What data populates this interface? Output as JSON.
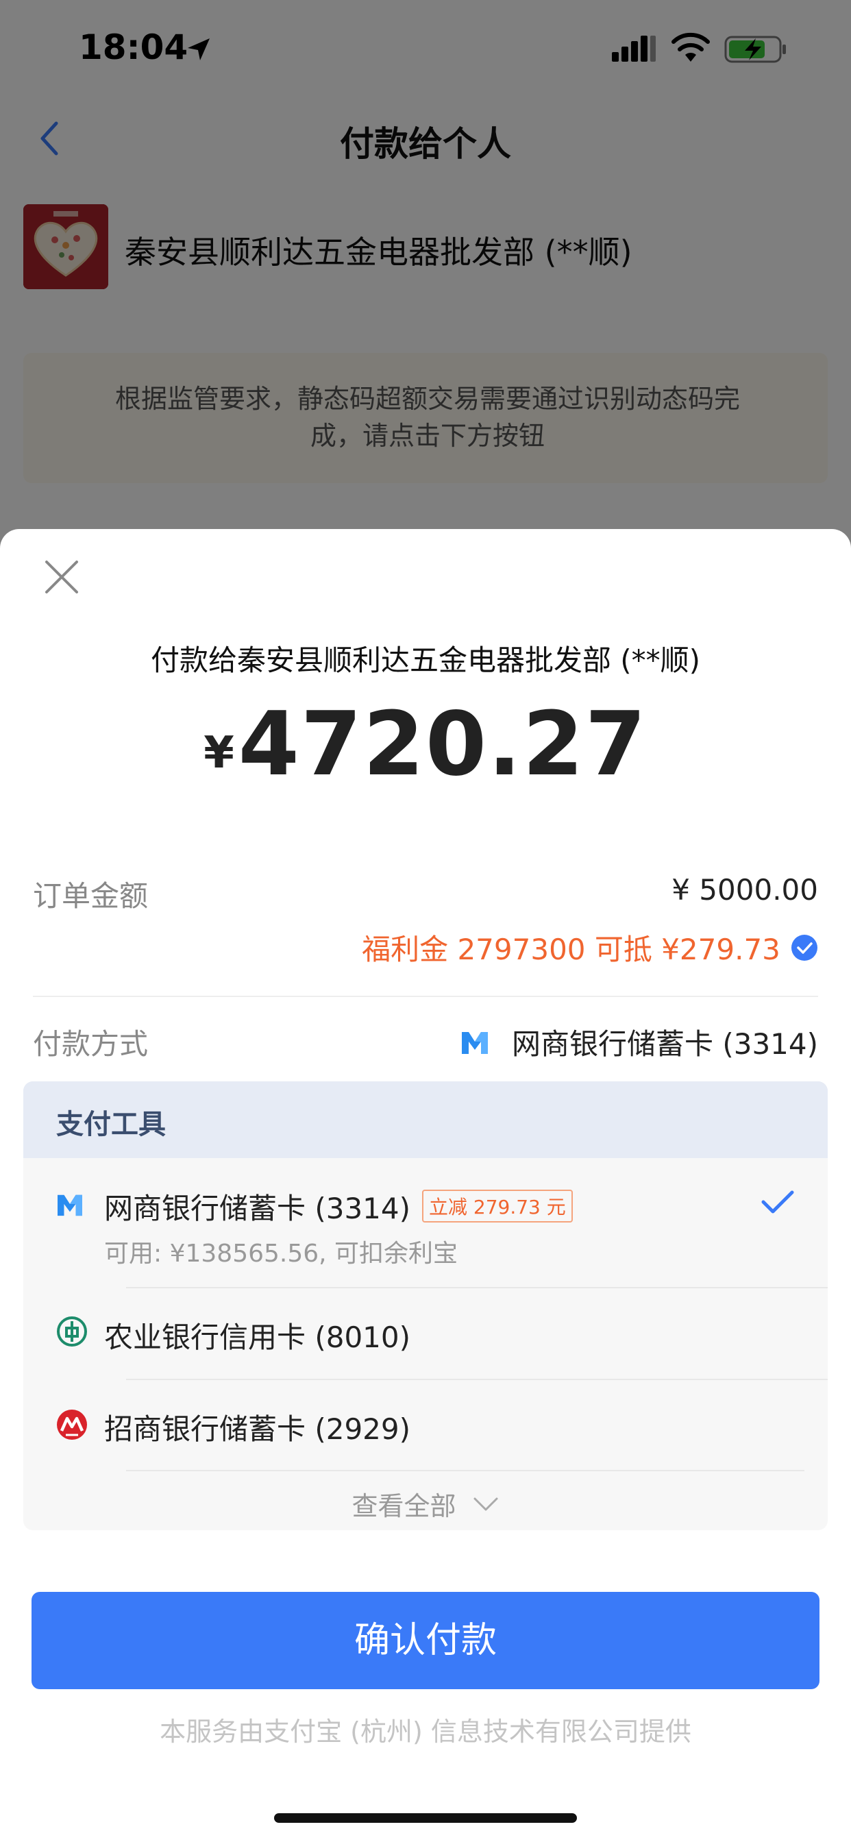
{
  "status_bar": {
    "time": "18:04",
    "icons": [
      "location-arrow-icon",
      "signal-icon",
      "wifi-icon",
      "battery-charging-icon"
    ]
  },
  "nav": {
    "title": "付款给个人",
    "back_icon": "chevron-left-icon"
  },
  "merchant": {
    "name": "秦安县顺利达五金电器批发部 (**顺)",
    "avatar_icon": "heart-image"
  },
  "notice": {
    "text": "根据监管要求，静态码超额交易需要通过识别动态码完成，请点击下方按钮"
  },
  "sheet": {
    "close_icon": "close-icon",
    "pay_to": "付款给秦安县顺利达五金电器批发部 (**顺)",
    "currency_symbol": "¥",
    "amount": "4720.27",
    "order_amount_label": "订单金额",
    "order_amount_value": "¥ 5000.00",
    "discount_text": "福利金 2797300 可抵 ¥279.73",
    "payment_method_label": "付款方式",
    "payment_method_value": "网商银行储蓄卡 (3314)",
    "tools": {
      "title": "支付工具",
      "options": [
        {
          "label": "网商银行储蓄卡 (3314)",
          "badge": "立减 279.73 元",
          "sub": "可用: ¥138565.56, 可扣余利宝",
          "icon": "mybank-icon",
          "selected": true
        },
        {
          "label": "农业银行信用卡 (8010)",
          "icon": "abc-bank-icon",
          "selected": false
        },
        {
          "label": "招商银行储蓄卡 (2929)",
          "icon": "cmb-bank-icon",
          "selected": false
        }
      ],
      "view_all": "查看全部"
    },
    "confirm_button": "确认付款",
    "footer": "本服务由支付宝 (杭州) 信息技术有限公司提供"
  },
  "colors": {
    "accent_blue": "#3a7af8",
    "discount_orange": "#f0652f",
    "tools_header_bg": "#e6ebf5",
    "abc_green": "#1d8c6b",
    "cmb_red": "#d9232b"
  }
}
